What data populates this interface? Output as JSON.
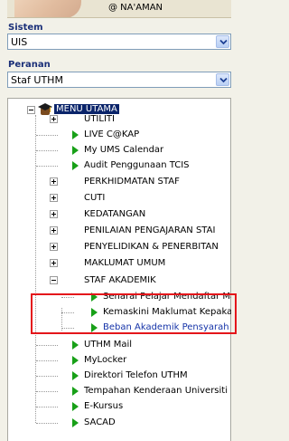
{
  "user": {
    "name": "@ NA'AMAN"
  },
  "sistem": {
    "label": "Sistem",
    "value": "UIS"
  },
  "peranan": {
    "label": "Peranan",
    "value": "Staf UTHM"
  },
  "tree": {
    "root": "MENU UTAMA",
    "items": [
      {
        "label": "UTILITI",
        "type": "folder"
      },
      {
        "label": "LIVE C@KAP",
        "type": "link"
      },
      {
        "label": "My UMS Calendar",
        "type": "link"
      },
      {
        "label": "Audit Penggunaan TCIS",
        "type": "link"
      },
      {
        "label": "PERKHIDMATAN STAF",
        "type": "folder"
      },
      {
        "label": "CUTI",
        "type": "folder"
      },
      {
        "label": "KEDATANGAN",
        "type": "folder"
      },
      {
        "label": "PENILAIAN PENGAJARAN STAI",
        "type": "folder"
      },
      {
        "label": "PENYELIDIKAN & PENERBITAN",
        "type": "folder"
      },
      {
        "label": "MAKLUMAT UMUM",
        "type": "folder"
      },
      {
        "label": "STAF AKADEMIK",
        "type": "folder-open"
      },
      {
        "label": "Senarai Pelajar Mendaftar Ma",
        "type": "sublink"
      },
      {
        "label": "Kemaskini Maklumat Kepakar",
        "type": "sublink"
      },
      {
        "label": "Beban Akademik Pensyarah",
        "type": "sublink-active"
      },
      {
        "label": "UTHM Mail",
        "type": "link"
      },
      {
        "label": "MyLocker",
        "type": "link"
      },
      {
        "label": "Direktori Telefon UTHM",
        "type": "link"
      },
      {
        "label": "Tempahan Kenderaan Universiti",
        "type": "link"
      },
      {
        "label": "E-Kursus",
        "type": "link"
      },
      {
        "label": "SACAD",
        "type": "link"
      }
    ]
  },
  "colors": {
    "highlight": "#e4161b",
    "arrow": "#18a018",
    "selected_bg": "#0a246a",
    "active_link": "#1533a8"
  }
}
